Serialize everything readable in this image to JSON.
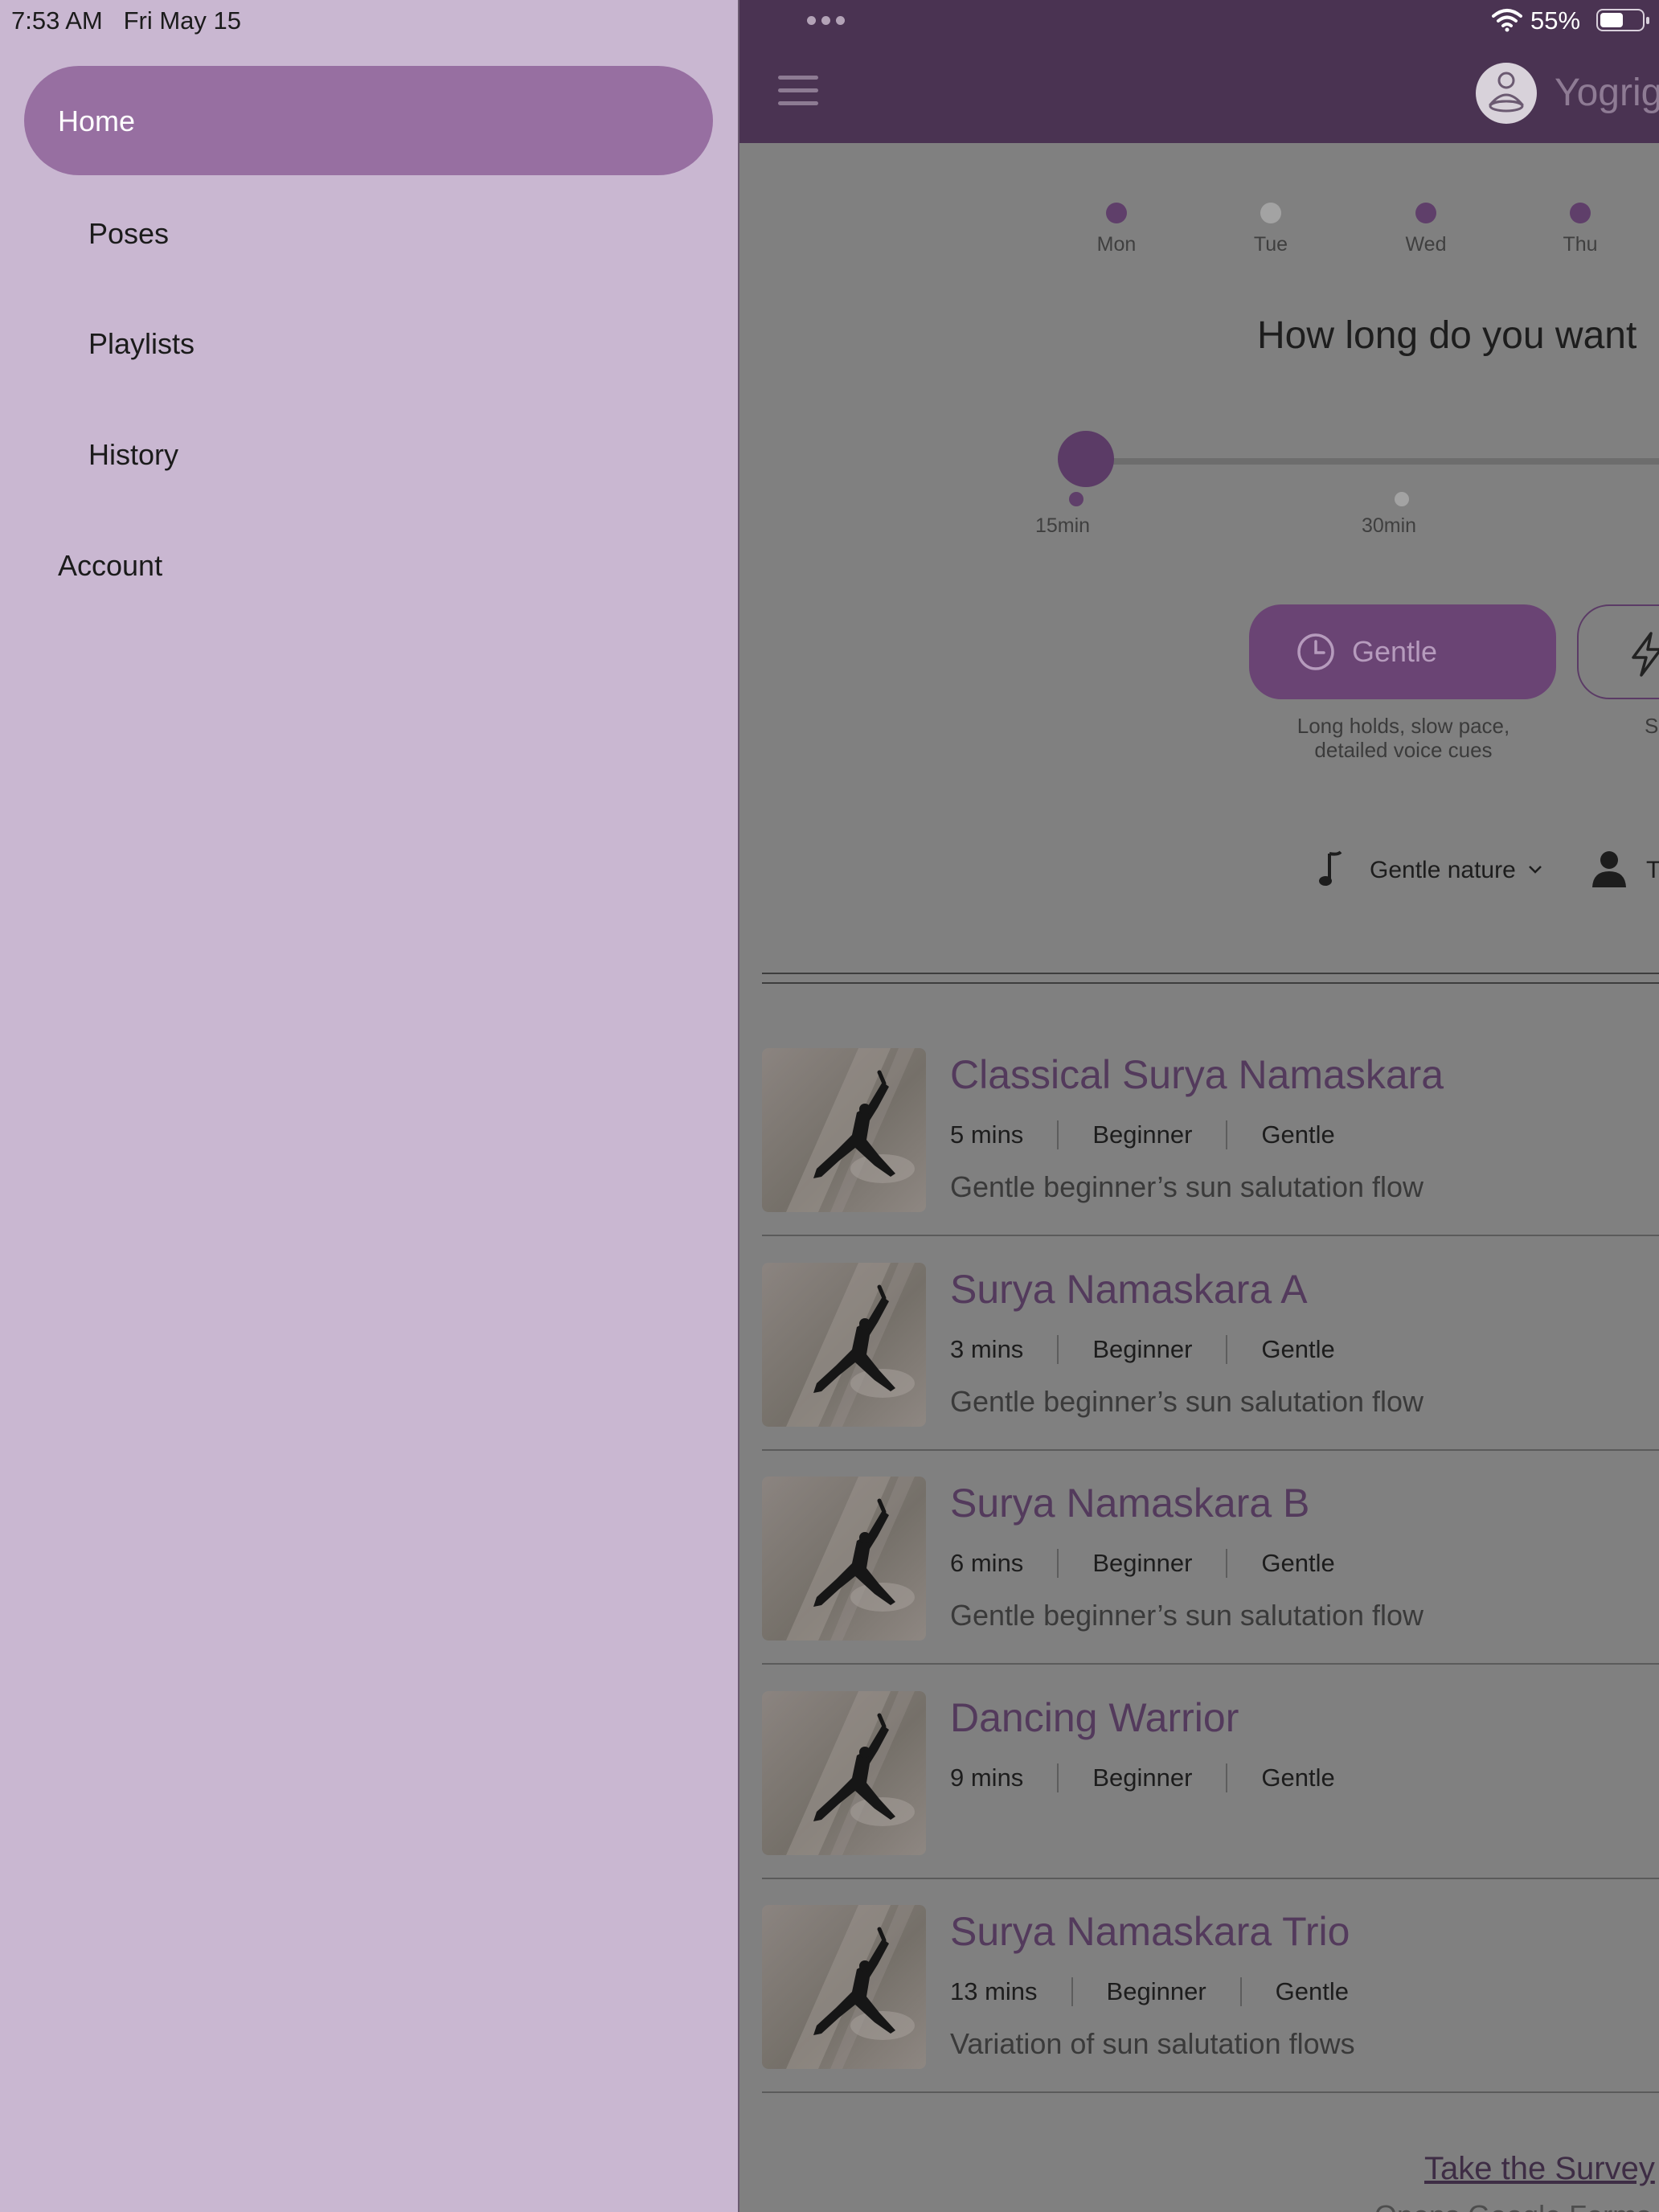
{
  "status_bar": {
    "time": "7:53 AM",
    "date": "Fri May 15",
    "battery": "55%"
  },
  "drawer": {
    "items": [
      {
        "label": "Home",
        "active": true
      },
      {
        "label": "Poses"
      },
      {
        "label": "Playlists"
      },
      {
        "label": "History"
      },
      {
        "label": "Account"
      }
    ]
  },
  "header": {
    "brand": "Yogrig"
  },
  "schedule": {
    "days": [
      {
        "label": "Mon",
        "active": true
      },
      {
        "label": "Tue",
        "active": false
      },
      {
        "label": "Wed",
        "active": true
      },
      {
        "label": "Thu",
        "active": true
      }
    ]
  },
  "duration": {
    "question": "How long do you want",
    "ticks": [
      "15min",
      "30min"
    ],
    "selected": "15min"
  },
  "pace": {
    "selected_label": "Gentle",
    "selected_description": "Long holds, slow pace, detailed voice cues",
    "other_description": "S"
  },
  "options": {
    "music": "Gentle nature",
    "teacher": "T"
  },
  "playlists": [
    {
      "title": "Classical Surya Namaskara",
      "duration": "5 mins",
      "level": "Beginner",
      "style": "Gentle",
      "description": "Gentle beginner’s sun salutation flow"
    },
    {
      "title": "Surya Namaskara A",
      "duration": "3 mins",
      "level": "Beginner",
      "style": "Gentle",
      "description": "Gentle beginner’s sun salutation flow"
    },
    {
      "title": "Surya Namaskara B",
      "duration": "6 mins",
      "level": "Beginner",
      "style": "Gentle",
      "description": "Gentle beginner’s sun salutation flow"
    },
    {
      "title": "Dancing Warrior",
      "duration": "9 mins",
      "level": "Beginner",
      "style": "Gentle",
      "description": ""
    },
    {
      "title": "Surya Namaskara Trio",
      "duration": "13 mins",
      "level": "Beginner",
      "style": "Gentle",
      "description": "Variation of sun salutation flows"
    }
  ],
  "survey": {
    "link": "Take the Survey",
    "subtext": "Opens Google Forms"
  },
  "colors": {
    "drawer_bg": "#c9b7d1",
    "active_pill": "#976fa1",
    "header_bg": "#4a3352",
    "accent": "#5f3f6a",
    "scrim_bg": "#808080"
  }
}
